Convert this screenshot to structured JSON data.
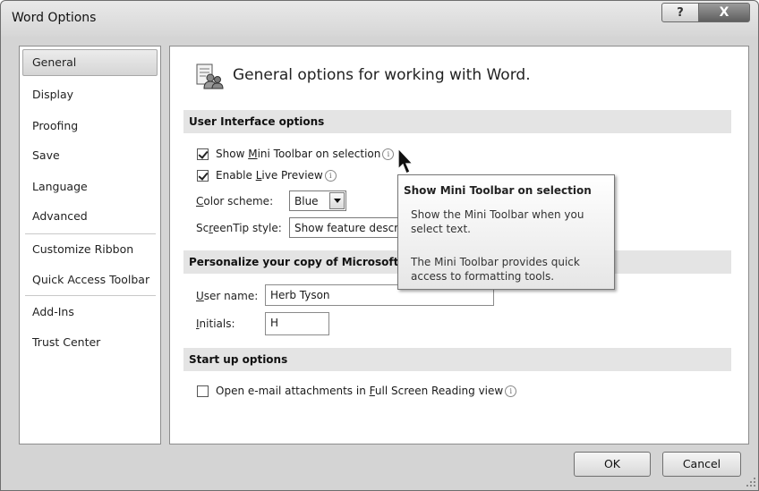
{
  "window": {
    "title": "Word Options",
    "help_glyph": "?",
    "close_glyph": "X"
  },
  "sidebar": {
    "items": [
      {
        "label": "General",
        "selected": true
      },
      {
        "label": "Display"
      },
      {
        "label": "Proofing"
      },
      {
        "label": "Save"
      },
      {
        "label": "Language"
      },
      {
        "label": "Advanced"
      },
      {
        "label": "Customize Ribbon"
      },
      {
        "label": "Quick Access Toolbar"
      },
      {
        "label": "Add-Ins"
      },
      {
        "label": "Trust Center"
      }
    ]
  },
  "main": {
    "header_title": "General options for working with Word.",
    "header_icon": "general-options-icon",
    "ui_section": {
      "title": "User Interface options",
      "mini_toolbar": {
        "label_pre": "Show ",
        "label_key": "M",
        "label_post": "ini Toolbar on selection",
        "checked": true
      },
      "live_preview": {
        "label_pre": "Enable ",
        "label_key": "L",
        "label_post": "ive Preview",
        "checked": true
      },
      "color_scheme": {
        "label_key": "C",
        "label_post": "olor scheme:",
        "value": "Blue"
      },
      "screentip": {
        "label_pre": "Sc",
        "label_key": "r",
        "label_post": "eenTip style:",
        "value": "Show feature descr"
      }
    },
    "personalize_section": {
      "title": "Personalize your copy of Microsoft O",
      "user_name": {
        "label_key": "U",
        "label_post": "ser name:",
        "value": "Herb Tyson"
      },
      "initials": {
        "label_key": "I",
        "label_post": "nitials:",
        "value": "H"
      }
    },
    "startup_section": {
      "title": "Start up options",
      "open_email": {
        "label_pre": "Open e-mail attachments in ",
        "label_key": "F",
        "label_post": "ull Screen Reading view",
        "checked": false
      }
    }
  },
  "tooltip": {
    "title": "Show Mini Toolbar on selection",
    "body1": "Show the Mini Toolbar when you select text.",
    "body2": "The Mini Toolbar provides quick access to formatting tools."
  },
  "footer": {
    "ok_label": "OK",
    "cancel_label": "Cancel"
  },
  "info_glyph": "i",
  "colors": {
    "window_bg": "#d4d4d4",
    "section_bg": "#e4e4e4",
    "tooltip_border": "#767676"
  }
}
